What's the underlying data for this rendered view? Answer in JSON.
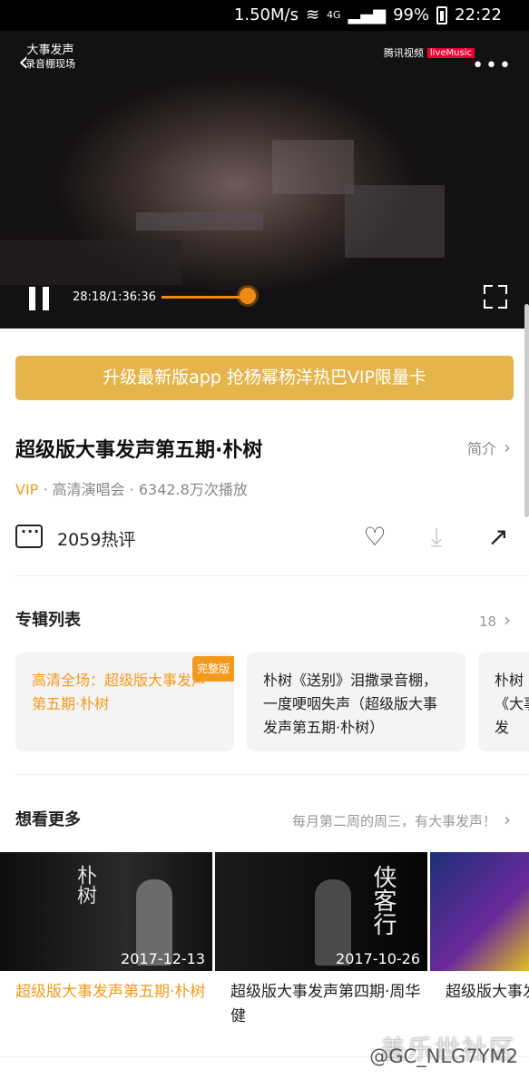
{
  "status": {
    "speed": "1.50M/s",
    "net": "4G",
    "battery": "99%",
    "time": "22:22"
  },
  "video": {
    "show_name": "大事发声",
    "show_sub": "录音棚现场",
    "brand": "腾讯视频",
    "brand_live": "liveMusic",
    "time": "28:18/1:36:36",
    "progress": 0.29
  },
  "vip_banner": "升级最新版app 抢杨幂杨洋热巴VIP限量卡",
  "title": "超级版大事发声第五期·朴树",
  "intro": "简介",
  "meta": {
    "vip": "VIP",
    "rest": " · 高清演唱会 · 6342.8万次播放"
  },
  "comments": "2059热评",
  "album": {
    "header": "专辑列表",
    "count": "18",
    "items": [
      {
        "title": "高清全场：超级版大事发声第五期·朴树",
        "badge": "完整版"
      },
      {
        "title": "朴树《送别》泪撒录音棚，一度哽咽失声（超级版大事发声第五期·朴树）"
      },
      {
        "title": "朴树《大事发"
      }
    ]
  },
  "more": {
    "header": "想看更多",
    "sub": "每月第二周的周三，有大事发声！",
    "items": [
      {
        "date": "2017-12-13",
        "title": "超级版大事发声第五期·朴树",
        "thumb_text": "朴树"
      },
      {
        "date": "2017-10-26",
        "title": "超级版大事发声第四期·周华健",
        "thumb_text": "侠客行"
      },
      {
        "date": "",
        "title": "超级版大事发"
      }
    ]
  },
  "watermark": "盖乐世社区",
  "watermark_user": "@GC_NLG7YM2",
  "colors": {
    "accent": "#f39a1e",
    "banner": "#e5b54c",
    "progress": "#f08a14"
  }
}
